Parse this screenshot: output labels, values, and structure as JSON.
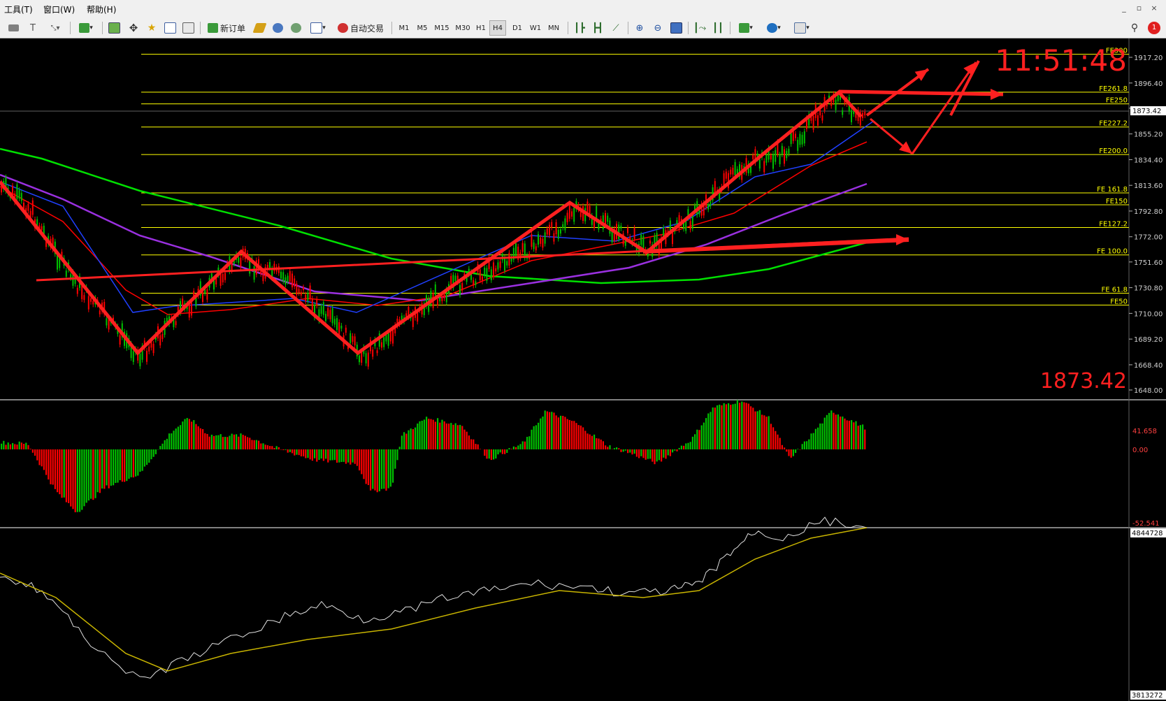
{
  "menu": [
    "工具(T)",
    "窗口(W)",
    "帮助(H)"
  ],
  "window_controls": [
    "_",
    "▫",
    "×"
  ],
  "toolbar": {
    "new_order_label": "新订单",
    "auto_trade_label": "自动交易",
    "timeframes": [
      "M1",
      "M5",
      "M15",
      "M30",
      "H1",
      "H4",
      "D1",
      "W1",
      "MN"
    ],
    "active_timeframe": "H4",
    "notification_count": "1"
  },
  "main_chart": {
    "time_display": "11:51:48",
    "current_price": "1873.42",
    "bid_tag": "1873.42",
    "price_axis": [
      "1917.20",
      "1896.40",
      "1876.00",
      "1855.20",
      "1834.40",
      "1813.60",
      "1792.80",
      "1772.00",
      "1751.60",
      "1730.80",
      "1710.00",
      "1689.20",
      "1668.40",
      "1648.00"
    ],
    "fib_levels": [
      {
        "label": "FE300",
        "price": 1919.7
      },
      {
        "label": "FE261.8",
        "price": 1889.0
      },
      {
        "label": "FE250",
        "price": 1879.5
      },
      {
        "label": "FE227.2",
        "price": 1860.8
      },
      {
        "label": "FE200.0",
        "price": 1838.5
      },
      {
        "label": "FE 161.8",
        "price": 1807.5
      },
      {
        "label": "FE150",
        "price": 1797.9
      },
      {
        "label": "FE127.2",
        "price": 1779.5
      },
      {
        "label": "FE 100.0",
        "price": 1757.3
      },
      {
        "label": "FE 61.8",
        "price": 1726.3
      },
      {
        "label": "FE50",
        "price": 1716.7
      }
    ],
    "colors": {
      "line": "#ffff00",
      "arrow": "#ff2020",
      "bull": "#00c000",
      "bear": "#ff0000",
      "ma_green": "#00e000",
      "ma_purple": "#9a30e0",
      "ma_blue": "#2040ff"
    }
  },
  "macd": {
    "max_label": "41.658",
    "zero_label": "0.00",
    "min_label": "-52.541"
  },
  "volume_ind": {
    "max_label": "4844728",
    "min_label": "3813272"
  }
}
